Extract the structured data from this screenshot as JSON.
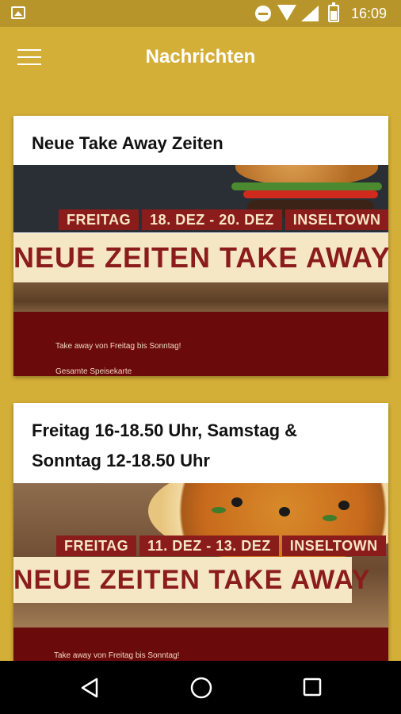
{
  "status_bar": {
    "time": "16:09"
  },
  "app_bar": {
    "title": "Nachrichten"
  },
  "cards": [
    {
      "title": "Neue Take Away Zeiten",
      "tags": [
        "FREITAG",
        "18. DEZ - 20. DEZ",
        "INSELTOWN"
      ],
      "headline": "NEUE ZEITEN TAKE AWAY",
      "lines": [
        "Take away von Freitag bis Sonntag!",
        "Gesamte Speisekarte"
      ]
    },
    {
      "title": "Freitag 16-18.50 Uhr, Samstag & Sonntag 12-18.50 Uhr",
      "tags": [
        "FREITAG",
        "11. DEZ - 13. DEZ",
        "INSELTOWN"
      ],
      "headline": "NEUE ZEITEN TAKE AWAY",
      "lines": [
        "Take away von Freitag bis Sonntag!"
      ]
    }
  ],
  "colors": {
    "app_background": "#D4AF37",
    "status_bar": "#B8952A",
    "accent_red": "#8B1C1C",
    "band_cream": "#F5E6C4",
    "footer_dark_red": "#6B0A0A",
    "nav_bar": "#000000"
  },
  "icons": {
    "status_left": "gallery-icon",
    "status_right": [
      "do-not-disturb-icon",
      "wifi-icon",
      "signal-icon",
      "battery-icon"
    ],
    "app_bar": "menu-icon",
    "nav": [
      "back-icon",
      "home-icon",
      "recents-icon"
    ]
  }
}
